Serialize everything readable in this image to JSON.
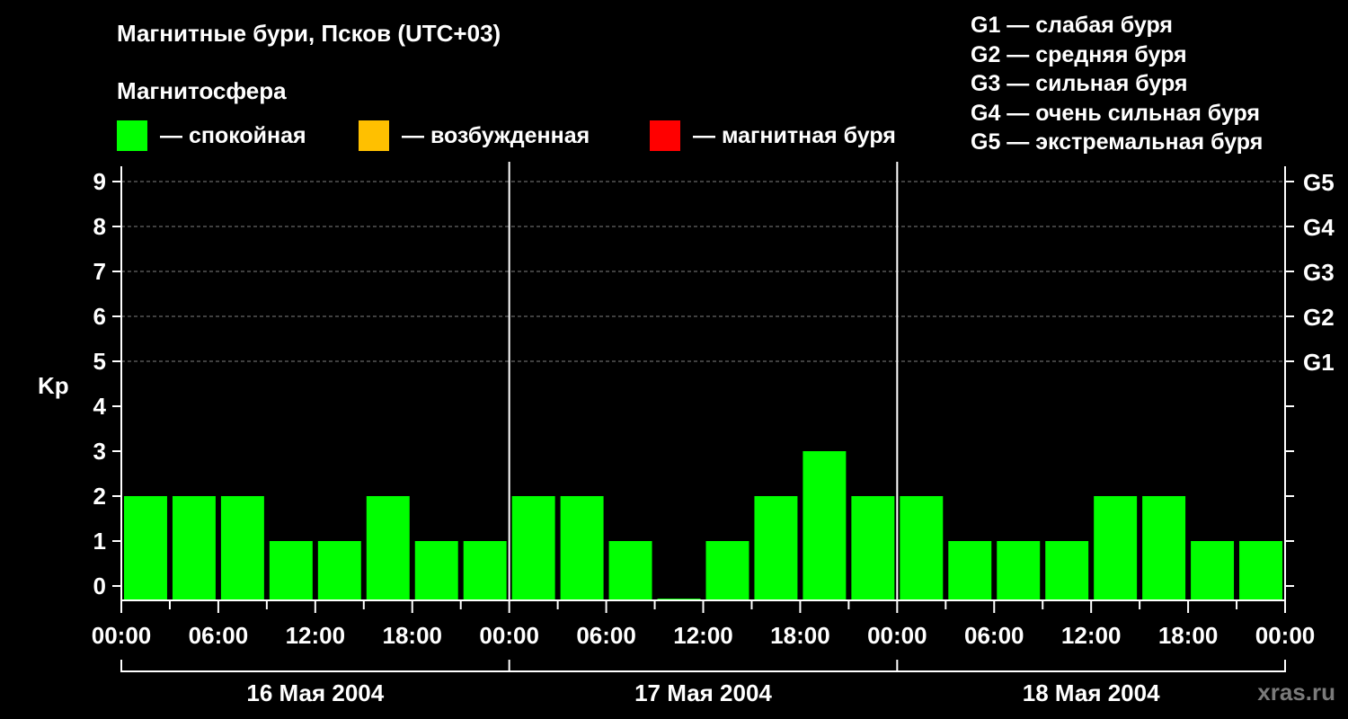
{
  "title": "Магнитные бури, Псков (UTC+03)",
  "subtitle": "Магнитосфера",
  "legend": [
    {
      "label": "— спокойная",
      "color": "#00ff00"
    },
    {
      "label": "— возбужденная",
      "color": "#ffc000"
    },
    {
      "label": "— магнитная буря",
      "color": "#ff0000"
    }
  ],
  "storm_scale": [
    "G1 — слабая буря",
    "G2 — средняя буря",
    "G3 — сильная буря",
    "G4 — очень сильная буря",
    "G5 — экстремальная буря"
  ],
  "watermark": "xras.ru",
  "chart_data": {
    "type": "bar",
    "ylabel": "Kp",
    "ylim": [
      0,
      9
    ],
    "y_ticks": [
      "0",
      "1",
      "2",
      "3",
      "4",
      "5",
      "6",
      "7",
      "8",
      "9"
    ],
    "right_labels": [
      "G1",
      "G2",
      "G3",
      "G4",
      "G5"
    ],
    "x_tick_labels": [
      "00:00",
      "06:00",
      "12:00",
      "18:00",
      "00:00",
      "06:00",
      "12:00",
      "18:00",
      "00:00",
      "06:00",
      "12:00",
      "18:00",
      "00:00"
    ],
    "days": [
      "16 Мая 2004",
      "17 Мая 2004",
      "18 Мая 2004"
    ],
    "values": [
      2,
      2,
      2,
      1,
      1,
      2,
      1,
      1,
      2,
      2,
      1,
      0,
      1,
      2,
      3,
      2,
      2,
      1,
      1,
      1,
      2,
      2,
      1,
      1
    ],
    "bar_color": "#00ff00",
    "grid": true
  }
}
